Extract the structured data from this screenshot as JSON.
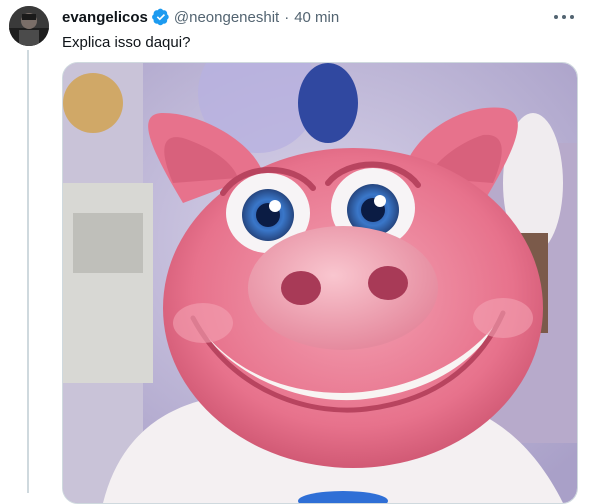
{
  "tweet": {
    "author_name": "evangelicos",
    "verified": true,
    "handle": "@neongeneshit",
    "separator": "·",
    "time": "40 min",
    "text": "Explica isso daqui?"
  },
  "media": {
    "description_icon": "pig-mascot-image"
  },
  "icons": {
    "verified": "verified-badge-icon",
    "more": "more-options-icon"
  },
  "colors": {
    "verified_blue": "#1d9bf0",
    "secondary_text": "#536471",
    "pig_pink": "#e9768f"
  }
}
